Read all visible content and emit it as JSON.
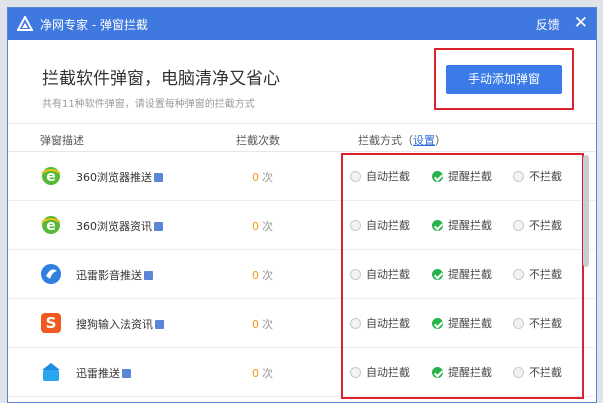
{
  "window": {
    "title": "净网专家 - 弹窗拦截",
    "feedback_label": "反馈",
    "close_label": "✕"
  },
  "header": {
    "headline": "拦截软件弹窗，电脑清净又省心",
    "subline": "共有11种软件弹窗，请设置每种弹窗的拦截方式",
    "add_button": "手动添加弹窗"
  },
  "columns": {
    "desc": "弹窗描述",
    "count": "拦截次数",
    "method": "拦截方式（",
    "method_link": "设置",
    "method_close": "）"
  },
  "options": {
    "auto": "自动拦截",
    "remind": "提醒拦截",
    "none": "不拦截"
  },
  "count_unit": "次",
  "rows": [
    {
      "name": "360浏览器推送",
      "count": "0",
      "icon": "ie-green-icon",
      "selected": "remind"
    },
    {
      "name": "360浏览器资讯",
      "count": "0",
      "icon": "ie-green-icon",
      "selected": "remind"
    },
    {
      "name": "迅雷影音推送",
      "count": "0",
      "icon": "xunlei-video-icon",
      "selected": "remind"
    },
    {
      "name": "搜狗输入法资讯",
      "count": "0",
      "icon": "sogou-icon",
      "selected": "remind"
    },
    {
      "name": "迅雷推送",
      "count": "0",
      "icon": "xunlei-icon",
      "selected": "remind"
    }
  ],
  "colors": {
    "accent": "#3f78de",
    "highlight": "#d9232f",
    "selected": "#27b24a",
    "count": "#f39a1b"
  }
}
